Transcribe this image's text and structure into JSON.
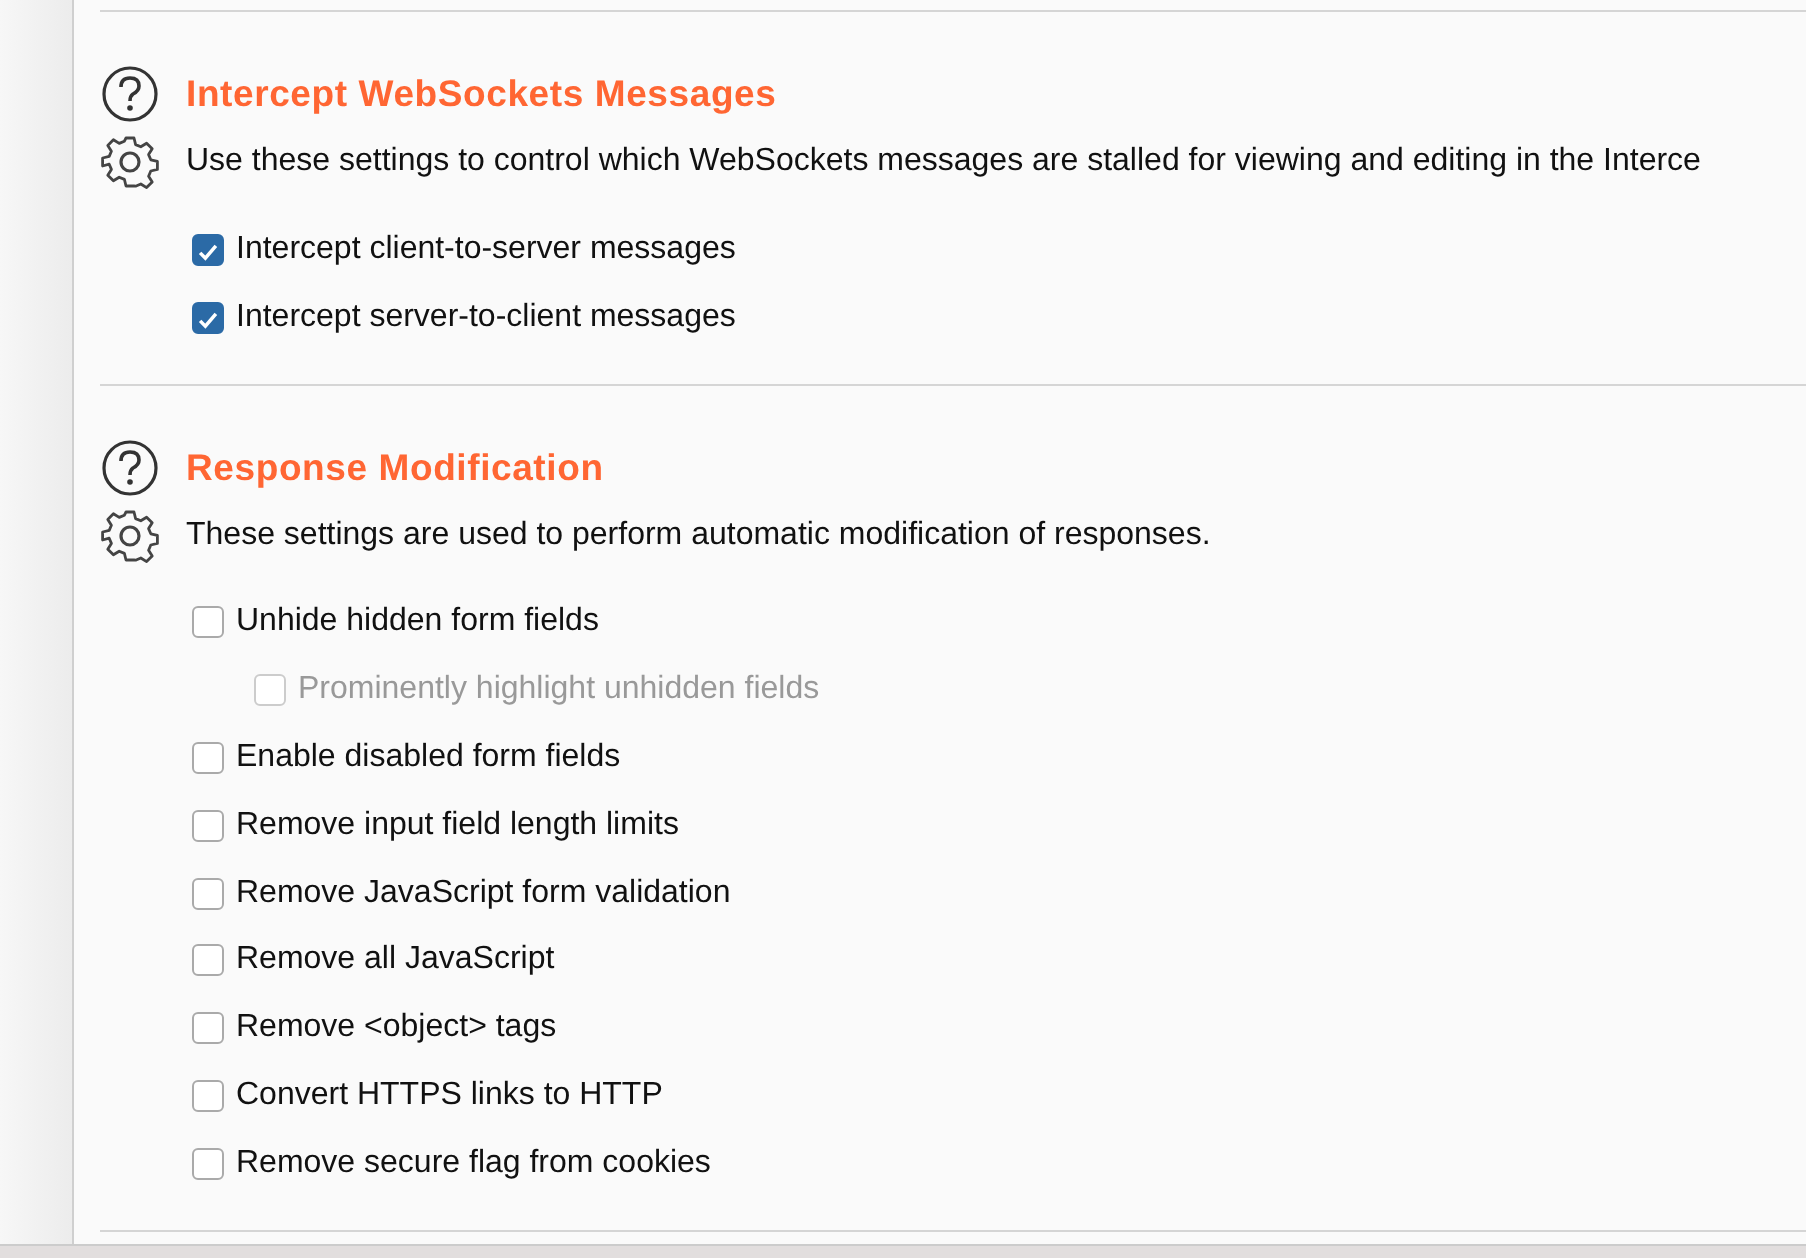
{
  "sections": [
    {
      "title": "Intercept WebSockets Messages",
      "description": "Use these settings to control which WebSockets messages are stalled for viewing and editing in the Interce",
      "options": [
        {
          "label": "Intercept client-to-server messages",
          "checked": true,
          "disabled": false
        },
        {
          "label": "Intercept server-to-client messages",
          "checked": true,
          "disabled": false
        }
      ]
    },
    {
      "title": "Response Modification",
      "description": "These settings are used to perform automatic modification of responses.",
      "options": [
        {
          "label": "Unhide hidden form fields",
          "checked": false,
          "disabled": false,
          "children": [
            {
              "label": "Prominently highlight unhidden fields",
              "checked": false,
              "disabled": true
            }
          ]
        },
        {
          "label": "Enable disabled form fields",
          "checked": false,
          "disabled": false
        },
        {
          "label": "Remove input field length limits",
          "checked": false,
          "disabled": false
        },
        {
          "label": "Remove JavaScript form validation",
          "checked": false,
          "disabled": false
        },
        {
          "label": "Remove all JavaScript",
          "checked": false,
          "disabled": false
        },
        {
          "label": "Remove <object> tags",
          "checked": false,
          "disabled": false
        },
        {
          "label": "Convert HTTPS links to HTTP",
          "checked": false,
          "disabled": false
        },
        {
          "label": "Remove secure flag from cookies",
          "checked": false,
          "disabled": false
        }
      ]
    }
  ]
}
